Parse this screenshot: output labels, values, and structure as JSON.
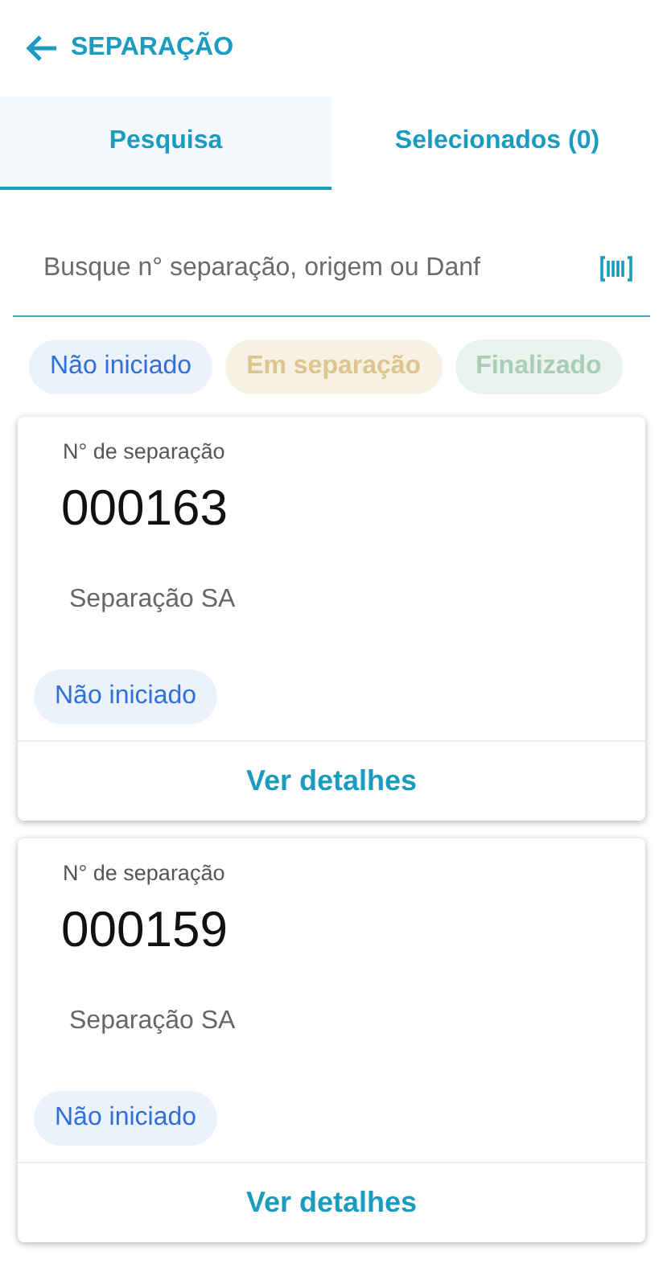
{
  "header": {
    "title": "SEPARAÇÃO"
  },
  "tabs": [
    {
      "label": "Pesquisa",
      "selected": true
    },
    {
      "label": "Selecionados (0)",
      "selected": false
    }
  ],
  "search": {
    "placeholder": "Busque n° separação, origem ou Danf"
  },
  "filters": [
    {
      "label": "Não iniciado",
      "selected": true,
      "color": "#2f6fd6"
    },
    {
      "label": "Em separação",
      "selected": false,
      "color": "#dcc58f"
    },
    {
      "label": "Finalizado",
      "selected": false,
      "color": "#a9cdb5"
    }
  ],
  "cards": [
    {
      "number_label": "N° de separação",
      "number": "000163",
      "origin": "Separação SA",
      "status": {
        "label": "Não iniciado",
        "color": "#2f6fd6"
      },
      "action": "Ver detalhes"
    },
    {
      "number_label": "N° de separação",
      "number": "000159",
      "origin": "Separação SA",
      "status": {
        "label": "Não iniciado",
        "color": "#2f6fd6"
      },
      "action": "Ver detalhes"
    }
  ]
}
